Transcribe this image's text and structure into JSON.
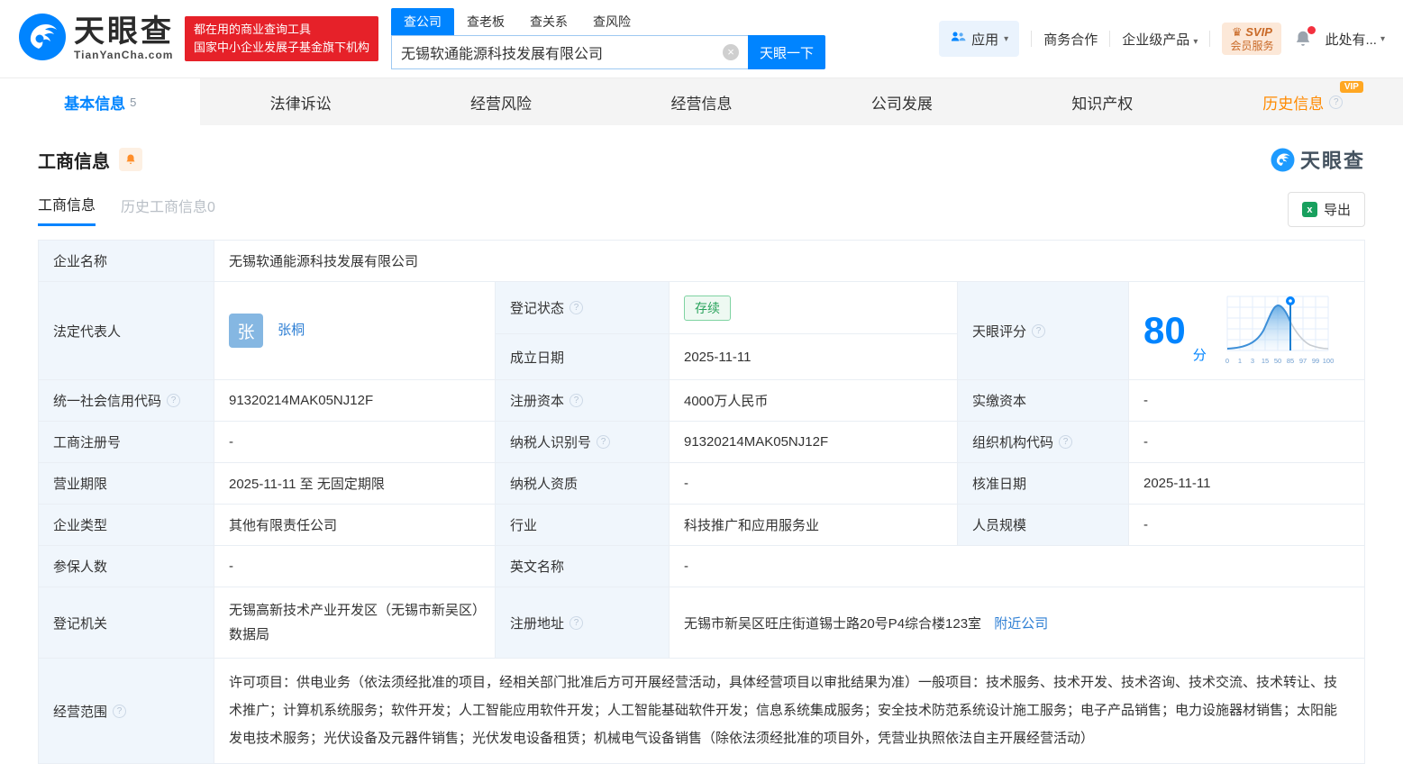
{
  "brand": {
    "logo_text": "天眼查",
    "logo_domain": "TianYanCha.com",
    "promo_line1": "都在用的商业查询工具",
    "promo_line2": "国家中小企业发展子基金旗下机构",
    "accent_blue": "#0084ff",
    "promo_red": "#e62129"
  },
  "search": {
    "tabs": [
      "查公司",
      "查老板",
      "查关系",
      "查风险"
    ],
    "active_tab": "查公司",
    "value": "无锡软通能源科技发展有限公司",
    "button_label": "天眼一下"
  },
  "top_nav": {
    "apps_label": "应用",
    "business_label": "商务合作",
    "enterprise_label": "企业级产品",
    "svip_line1": "SVIP",
    "svip_line2": "会员服务",
    "user_label": "此处有..."
  },
  "tabs": [
    {
      "label": "基本信息",
      "count": "5",
      "active": true
    },
    {
      "label": "法律诉讼"
    },
    {
      "label": "经营风险"
    },
    {
      "label": "经营信息"
    },
    {
      "label": "公司发展"
    },
    {
      "label": "知识产权"
    },
    {
      "label": "历史信息",
      "vip_badge": "VIP"
    }
  ],
  "section": {
    "title": "工商信息",
    "subtab_active": "工商信息",
    "subtab_history": "历史工商信息",
    "subtab_history_count": "0",
    "export_label": "导出",
    "watermark": "天眼查"
  },
  "fields": {
    "company_name": {
      "label": "企业名称",
      "value": "无锡软通能源科技发展有限公司"
    },
    "legal_rep": {
      "label": "法定代表人",
      "avatar": "张",
      "value": "张桐"
    },
    "reg_status": {
      "label": "登记状态",
      "value": "存续"
    },
    "establish_date": {
      "label": "成立日期",
      "value": "2025-11-11"
    },
    "tyc_score": {
      "label": "天眼评分",
      "score": "80",
      "unit": "分"
    },
    "credit_code": {
      "label": "统一社会信用代码",
      "value": "91320214MAK05NJ12F"
    },
    "reg_capital": {
      "label": "注册资本",
      "value": "4000万人民币"
    },
    "paid_capital": {
      "label": "实缴资本",
      "value": "-"
    },
    "reg_number": {
      "label": "工商注册号",
      "value": "-"
    },
    "taxpayer_id": {
      "label": "纳税人识别号",
      "value": "91320214MAK05NJ12F"
    },
    "org_code": {
      "label": "组织机构代码",
      "value": "-"
    },
    "business_term": {
      "label": "营业期限",
      "value": "2025-11-11 至 无固定期限"
    },
    "taxpayer_quality": {
      "label": "纳税人资质",
      "value": "-"
    },
    "approval_date": {
      "label": "核准日期",
      "value": "2025-11-11"
    },
    "company_type": {
      "label": "企业类型",
      "value": "其他有限责任公司"
    },
    "industry": {
      "label": "行业",
      "value": "科技推广和应用服务业"
    },
    "staff_size": {
      "label": "人员规模",
      "value": "-"
    },
    "insured_count": {
      "label": "参保人数",
      "value": "-"
    },
    "english_name": {
      "label": "英文名称",
      "value": "-"
    },
    "reg_authority": {
      "label": "登记机关",
      "value": "无锡高新技术产业开发区（无锡市新吴区）数据局"
    },
    "reg_address": {
      "label": "注册地址",
      "value": "无锡市新吴区旺庄街道锡士路20号P4综合楼123室",
      "link": "附近公司"
    },
    "business_scope": {
      "label": "经营范围",
      "value": "许可项目：供电业务（依法须经批准的项目，经相关部门批准后方可开展经营活动，具体经营项目以审批结果为准）一般项目：技术服务、技术开发、技术咨询、技术交流、技术转让、技术推广；计算机系统服务；软件开发；人工智能应用软件开发；人工智能基础软件开发；信息系统集成服务；安全技术防范系统设计施工服务；电子产品销售；电力设施器材销售；太阳能发电技术服务；光伏设备及元器件销售；光伏发电设备租赁；机械电气设备销售（除依法须经批准的项目外，凭营业执照依法自主开展经营活动）"
    }
  },
  "chart_data": {
    "type": "area",
    "title": "天眼评分",
    "x": [
      "0",
      "1",
      "3",
      "15",
      "50",
      "85",
      "97",
      "99",
      "100"
    ],
    "score": 80,
    "marker_value": 85,
    "curve_color": "#3d8fd8",
    "tail_color": "#c7ccd2",
    "grid": true
  }
}
